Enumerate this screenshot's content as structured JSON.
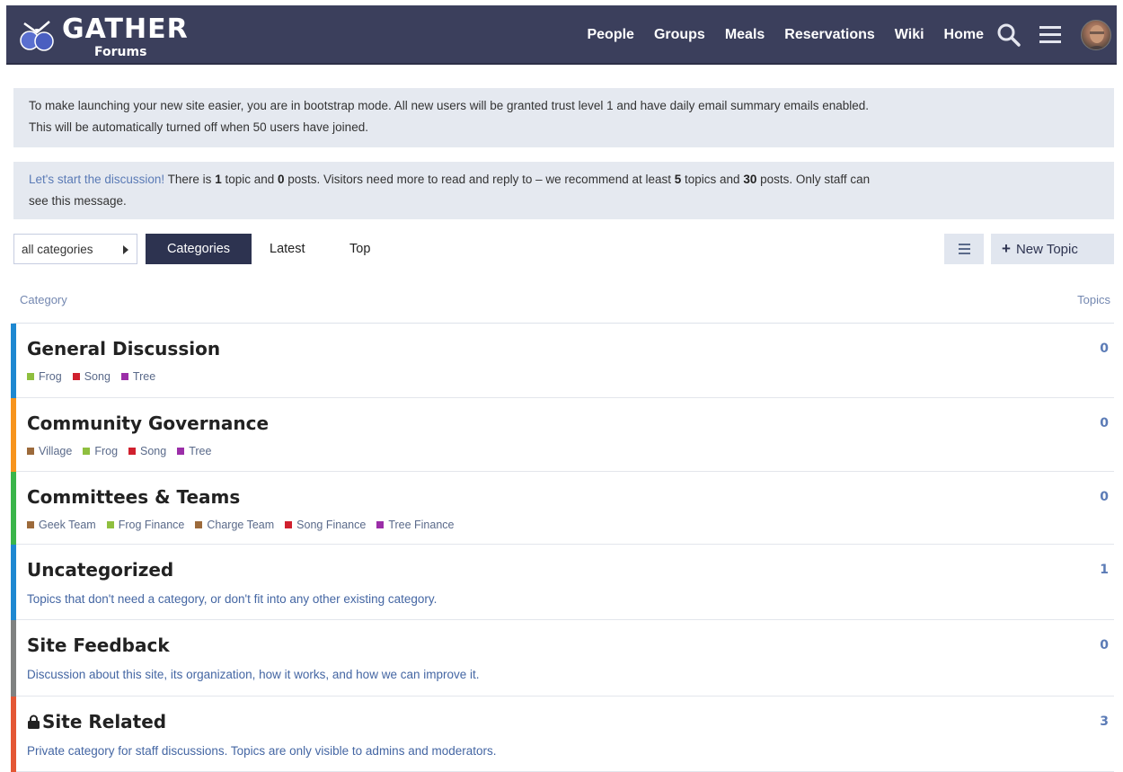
{
  "header": {
    "logo_title": "GATHER",
    "logo_sub": "Forums",
    "nav": [
      "People",
      "Groups",
      "Meals",
      "Reservations",
      "Wiki",
      "Home"
    ],
    "bg_color": "#3b3f5c"
  },
  "notices": {
    "bootstrap": {
      "line1": "To make launching your new site easier, you are in bootstrap mode. All new users will be granted trust level 1 and have daily email summary emails enabled.",
      "line2": "This will be automatically turned off when 50 users have joined."
    },
    "discussion": {
      "link": "Let's start the discussion!",
      "t1": " There is ",
      "topics_count": "1",
      "t2": " topic and ",
      "posts_count": "0",
      "t3": " posts. Visitors need more to read and reply to – we recommend at least ",
      "rec_topics": "5",
      "t4": " topics and ",
      "rec_posts": "30",
      "t5": " posts. Only staff can",
      "line2": "see this message."
    }
  },
  "controls": {
    "category_dropdown": "all categories",
    "tab_categories": "Categories",
    "tab_latest": "Latest",
    "tab_top": "Top",
    "new_topic": "New Topic"
  },
  "table": {
    "col_category": "Category",
    "col_topics": "Topics"
  },
  "categories": [
    {
      "name": "General Discussion",
      "color": "#1e88d1",
      "topics": "0",
      "subcategories": [
        {
          "name": "Frog",
          "color": "#8fbf3f"
        },
        {
          "name": "Song",
          "color": "#d0202e"
        },
        {
          "name": "Tree",
          "color": "#9b2ea8"
        }
      ]
    },
    {
      "name": "Community Governance",
      "color": "#f7941d",
      "topics": "0",
      "subcategories": [
        {
          "name": "Village",
          "color": "#9c6a3b"
        },
        {
          "name": "Frog",
          "color": "#8fbf3f"
        },
        {
          "name": "Song",
          "color": "#d0202e"
        },
        {
          "name": "Tree",
          "color": "#9b2ea8"
        }
      ]
    },
    {
      "name": "Committees & Teams",
      "color": "#3ab54a",
      "topics": "0",
      "subcategories": [
        {
          "name": "Geek Team",
          "color": "#9c6a3b"
        },
        {
          "name": "Frog Finance",
          "color": "#8fbf3f"
        },
        {
          "name": "Charge Team",
          "color": "#9c6a3b"
        },
        {
          "name": "Song Finance",
          "color": "#d0202e"
        },
        {
          "name": "Tree Finance",
          "color": "#9b2ea8"
        }
      ]
    },
    {
      "name": "Uncategorized",
      "color": "#1e88d1",
      "topics": "1",
      "description": "Topics that don't need a category, or don't fit into any other existing category."
    },
    {
      "name": "Site Feedback",
      "color": "#808281",
      "topics": "0",
      "description": "Discussion about this site, its organization, how it works, and how we can improve it."
    },
    {
      "name": "Site Related",
      "color": "#e45735",
      "topics": "3",
      "locked": true,
      "description": "Private category for staff discussions. Topics are only visible to admins and moderators."
    }
  ]
}
